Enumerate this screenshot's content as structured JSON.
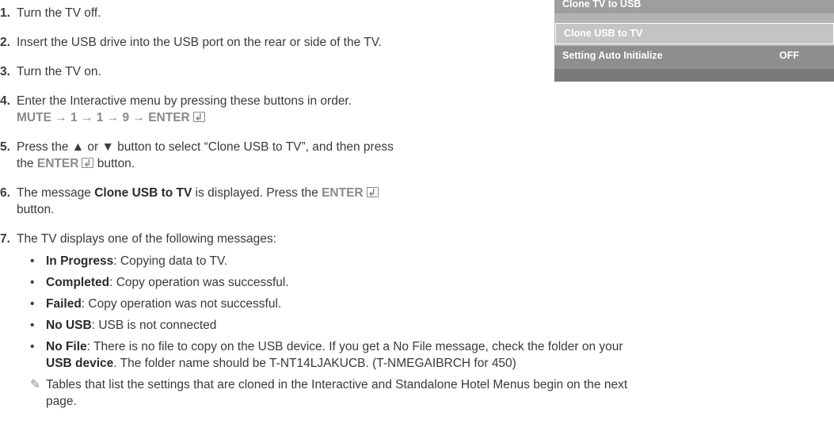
{
  "steps": [
    {
      "num": "1.",
      "text": "Turn the TV off."
    },
    {
      "num": "2.",
      "text": "Insert the USB drive into the USB port on the rear or side of the TV."
    },
    {
      "num": "3.",
      "text": "Turn the TV on."
    },
    {
      "num": "4.",
      "text": "Enter the Interactive menu by pressing these buttons in order.",
      "sequence": "MUTE → 1 → 1 → 9 → ENTER"
    },
    {
      "num": "5.",
      "text_a": "Press the ▲ or ▼ button to select “Clone USB to TV”, and then press",
      "text_b_pre": "the ",
      "text_b_btn": "ENTER",
      "text_b_post": " button."
    },
    {
      "num": "6.",
      "text_a_pre": "The message ",
      "text_a_bold": "Clone USB to TV",
      "text_a_mid": " is displayed. Press the ",
      "text_a_btn": "ENTER",
      "text_b": "button."
    },
    {
      "num": "7.",
      "text": "The TV displays one of the following messages:"
    }
  ],
  "bullets": [
    {
      "term": "In Progress",
      "desc": ": Copying data to TV."
    },
    {
      "term": "Completed",
      "desc": ": Copy operation was successful."
    },
    {
      "term": "Failed",
      "desc": ": Copy operation was not successful."
    },
    {
      "term": "No USB",
      "desc": ": USB is not connected"
    },
    {
      "term": "No File",
      "desc_a": ": There is no file to copy on the USB device. If you get a No File message, check the folder on your",
      "desc_b_bold": "USB device",
      "desc_b": ". The folder name should be T-NT14LJAKUCB. (T-NMEGAIBRCH for 450)"
    }
  ],
  "note": {
    "icon": "✎",
    "line1": "Tables that list the settings that are cloned in the Interactive and Standalone Hotel Menus begin on the next",
    "line2": "page."
  },
  "menu": {
    "items": [
      {
        "label": "Clone TV to USB",
        "value": ""
      },
      {
        "label": "Clone USB to TV",
        "value": ""
      },
      {
        "label": "Setting Auto Initialize",
        "value": "OFF"
      }
    ]
  }
}
